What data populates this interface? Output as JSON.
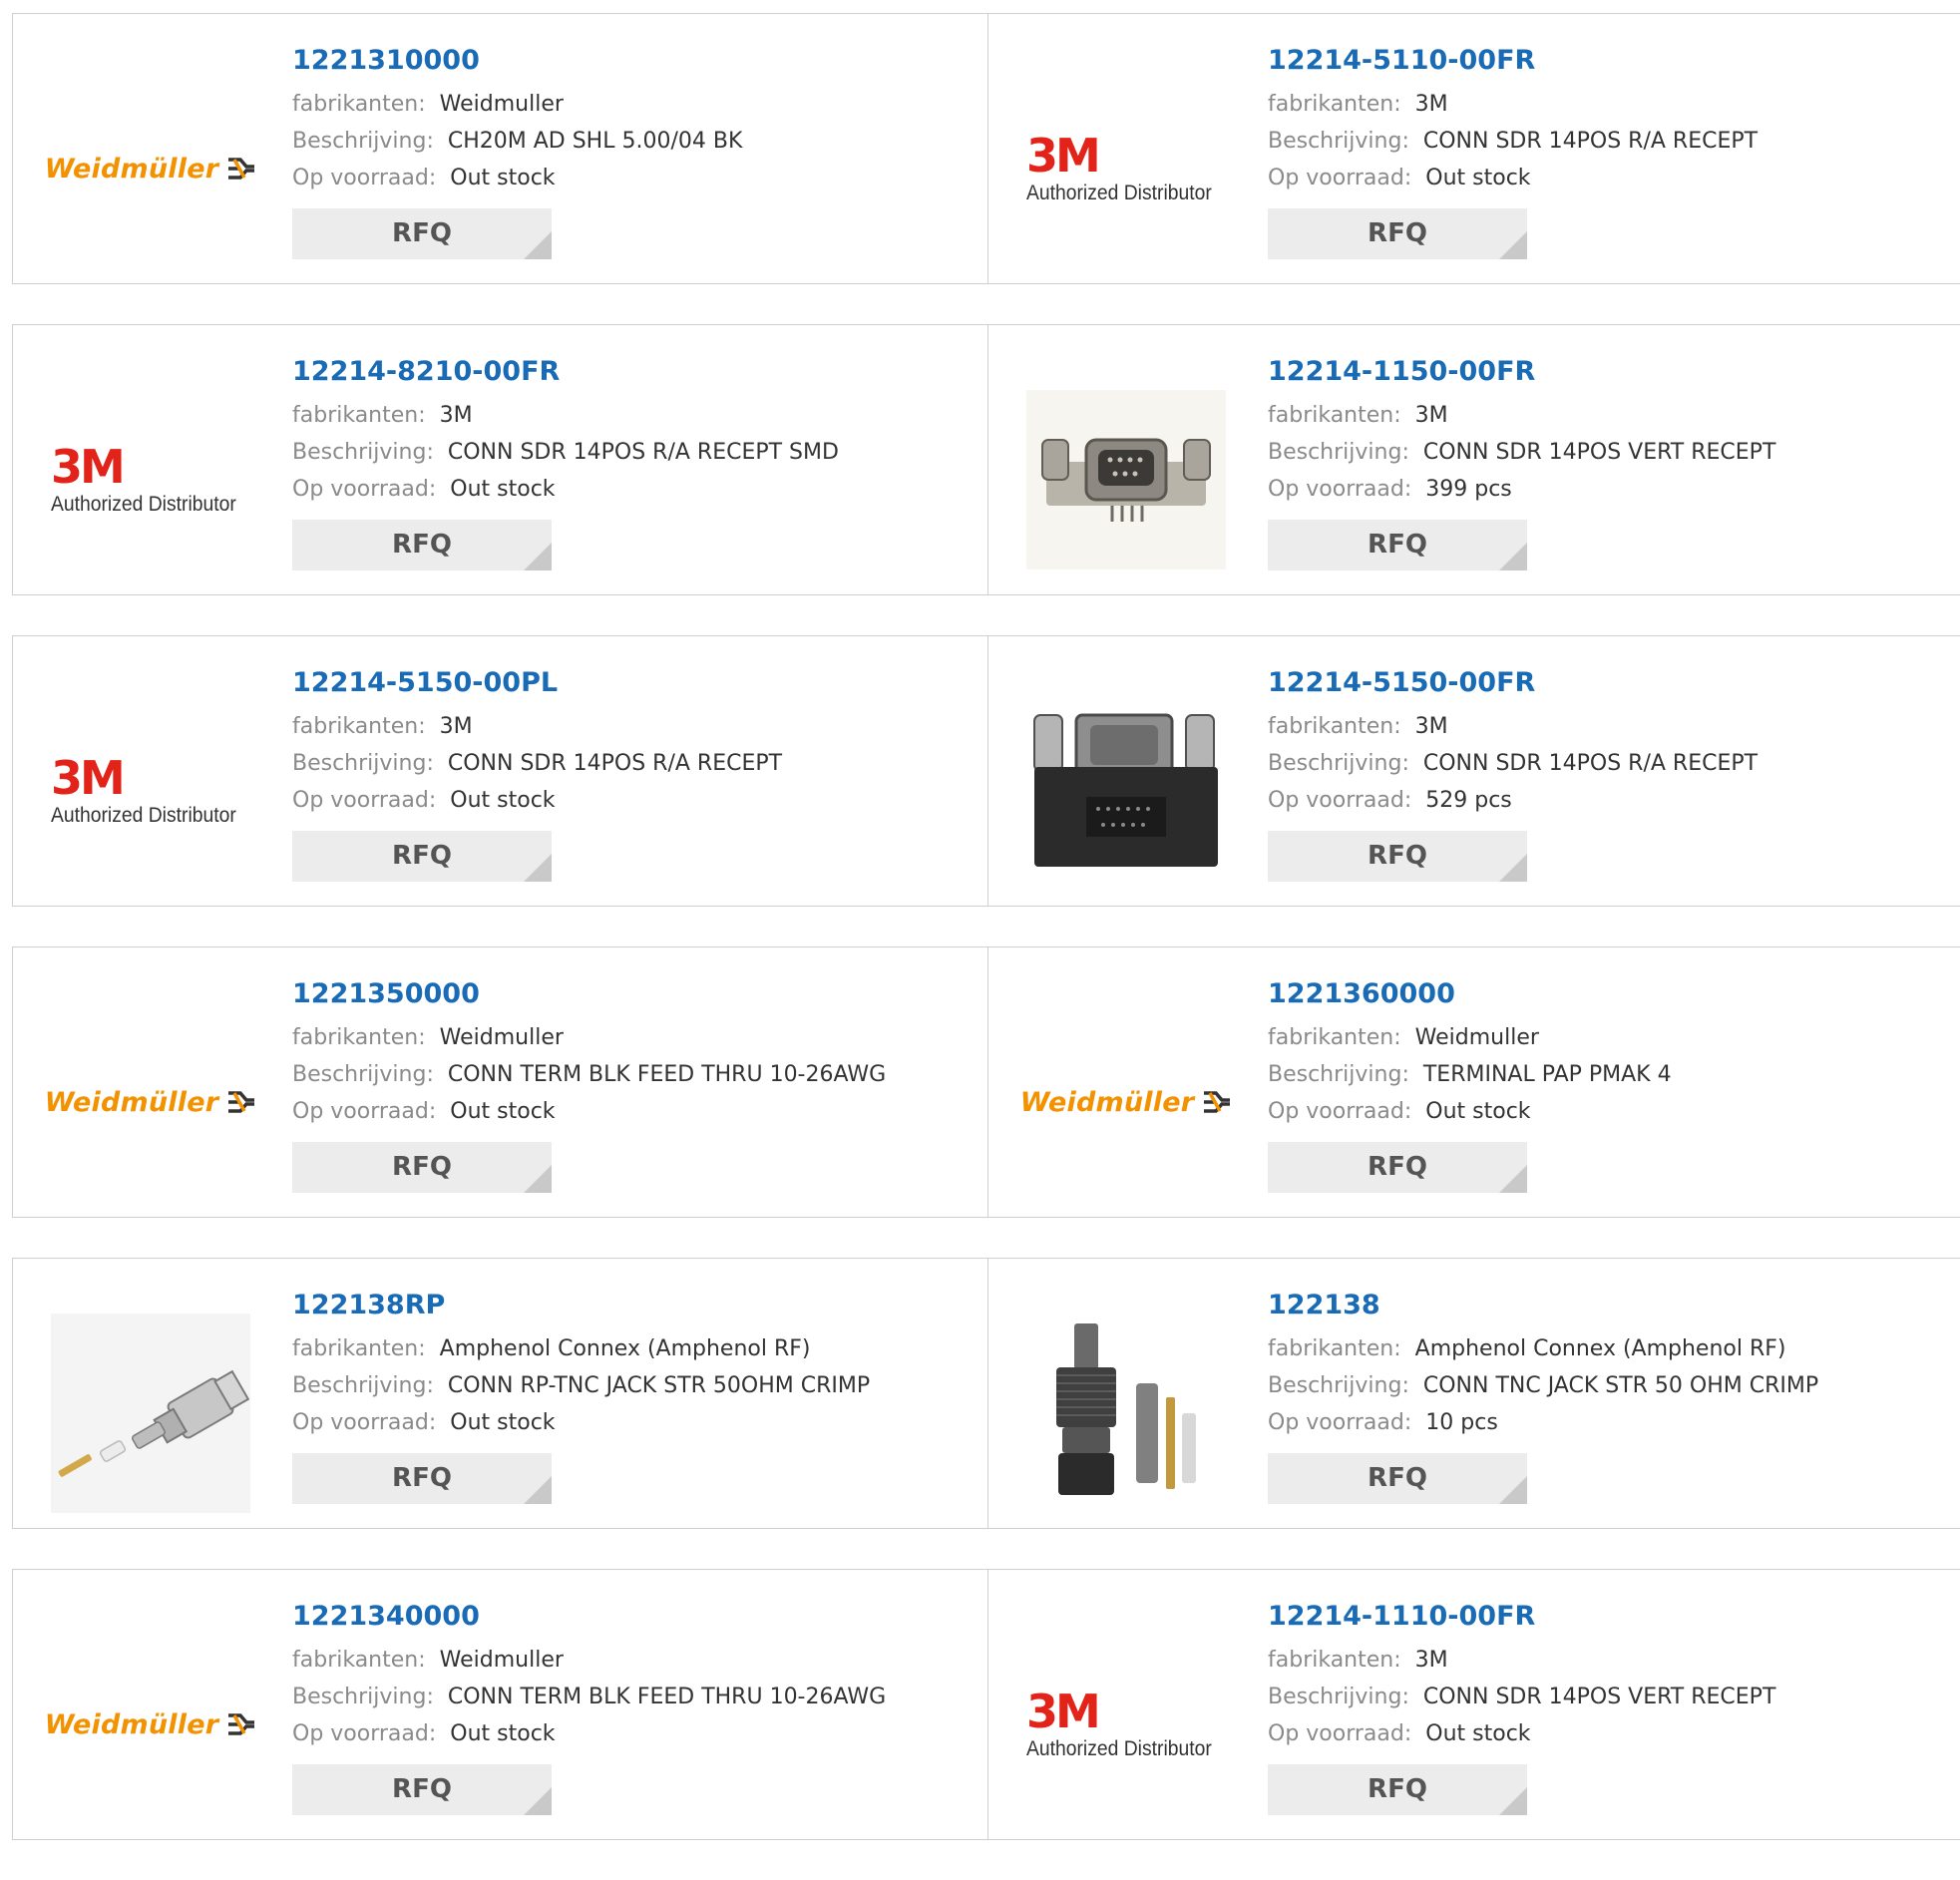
{
  "labels": {
    "manufacturer": "fabrikanten:",
    "description": "Beschrijving:",
    "stock": "Op voorraad:",
    "rfq": "RFQ"
  },
  "brands": {
    "weidmuller": {
      "text": "Weidmüller",
      "color": "#f39200",
      "icon": "weidmuller-mark-icon"
    },
    "3m": {
      "text": "3M",
      "subtext": "Authorized Distributor",
      "color": "#e2231a"
    }
  },
  "colors": {
    "part_link": "#1a6bb5",
    "label": "#8a8a8a",
    "value": "#333333",
    "rfq_bg": "#ececec"
  },
  "products": [
    {
      "part": "1221310000",
      "manufacturer": "Weidmuller",
      "description": "CH20M AD SHL 5.00/04 BK",
      "stock": "Out stock",
      "image": "weidmuller-logo"
    },
    {
      "part": "12214-5110-00FR",
      "manufacturer": "3M",
      "description": "CONN SDR 14POS R/A RECEPT",
      "stock": "Out stock",
      "image": "3m-logo"
    },
    {
      "part": "12214-8210-00FR",
      "manufacturer": "3M",
      "description": "CONN SDR 14POS R/A RECEPT SMD",
      "stock": "Out stock",
      "image": "3m-logo"
    },
    {
      "part": "12214-1150-00FR",
      "manufacturer": "3M",
      "description": "CONN SDR 14POS VERT RECEPT",
      "stock": "399 pcs",
      "image": "sdr-connector-photo"
    },
    {
      "part": "12214-5150-00PL",
      "manufacturer": "3M",
      "description": "CONN SDR 14POS R/A RECEPT",
      "stock": "Out stock",
      "image": "3m-logo"
    },
    {
      "part": "12214-5150-00FR",
      "manufacturer": "3M",
      "description": "CONN SDR 14POS R/A RECEPT",
      "stock": "529 pcs",
      "image": "sdr-ra-connector-photo"
    },
    {
      "part": "1221350000",
      "manufacturer": "Weidmuller",
      "description": "CONN TERM BLK FEED THRU 10-26AWG",
      "stock": "Out stock",
      "image": "weidmuller-logo"
    },
    {
      "part": "1221360000",
      "manufacturer": "Weidmuller",
      "description": "TERMINAL PAP PMAK 4",
      "stock": "Out stock",
      "image": "weidmuller-logo"
    },
    {
      "part": "122138RP",
      "manufacturer": "Amphenol Connex (Amphenol RF)",
      "description": "CONN RP-TNC JACK STR 50OHM CRIMP",
      "stock": "Out stock",
      "image": "rp-tnc-kit-photo"
    },
    {
      "part": "122138",
      "manufacturer": "Amphenol Connex (Amphenol RF)",
      "description": "CONN TNC JACK STR 50 OHM CRIMP",
      "stock": "10 pcs",
      "image": "tnc-jack-photo"
    },
    {
      "part": "1221340000",
      "manufacturer": "Weidmuller",
      "description": "CONN TERM BLK FEED THRU 10-26AWG",
      "stock": "Out stock",
      "image": "weidmuller-logo"
    },
    {
      "part": "12214-1110-00FR",
      "manufacturer": "3M",
      "description": "CONN SDR 14POS VERT RECEPT",
      "stock": "Out stock",
      "image": "3m-logo"
    }
  ]
}
